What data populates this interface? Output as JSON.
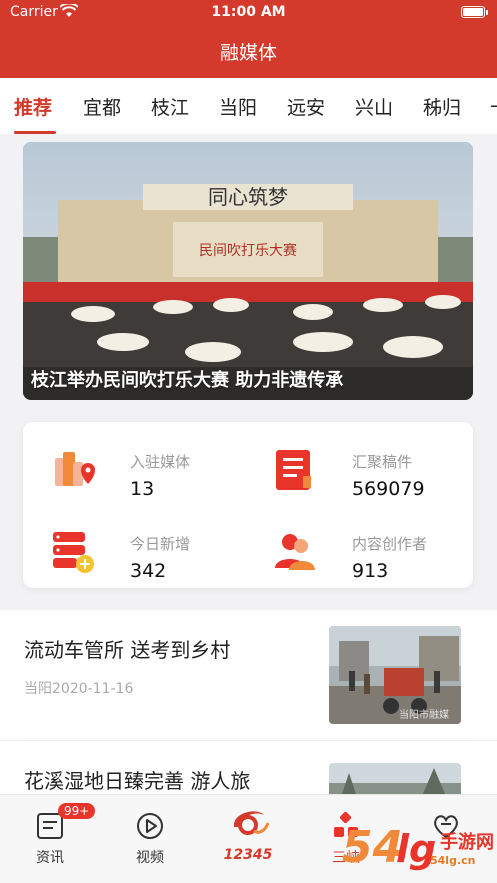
{
  "status_bar": {
    "carrier": "Carrier",
    "time": "11:00 AM"
  },
  "nav": {
    "title": "融媒体"
  },
  "channels": [
    "推荐",
    "宜都",
    "枝江",
    "当阳",
    "远安",
    "兴山",
    "秭归",
    "十"
  ],
  "active_channel": "推荐",
  "banner": {
    "caption": "枝江举办民间吹打乐大赛 助力非遗传承",
    "sign_text": "同心筑梦",
    "stage_text": "民间吹打乐大赛"
  },
  "stats": [
    {
      "label": "入驻媒体",
      "value": "13",
      "icon": "map-pin-building-icon"
    },
    {
      "label": "汇聚稿件",
      "value": "569079",
      "icon": "document-icon"
    },
    {
      "label": "今日新增",
      "value": "342",
      "icon": "server-add-icon"
    },
    {
      "label": "内容创作者",
      "value": "913",
      "icon": "users-icon"
    }
  ],
  "news": [
    {
      "headline": "流动车管所 送考到乡村",
      "meta": "当阳2020-11-16",
      "thumb_watermark": "当阳市融媒"
    },
    {
      "headline": "花溪湿地日臻完善 游人旅",
      "meta": ""
    }
  ],
  "tab_bar": {
    "items": [
      {
        "label": "资讯",
        "icon": "news-icon",
        "badge": "99+"
      },
      {
        "label": "视频",
        "icon": "play-icon"
      },
      {
        "label": "12345",
        "icon": "hotline-logo-icon"
      },
      {
        "label": "三峡",
        "icon": "grid-icon"
      },
      {
        "label": "",
        "icon": "heart-chat-icon"
      }
    ]
  },
  "watermark": {
    "text": "手游网",
    "domain": "54lg.cn"
  },
  "colors": {
    "brand_red": "#d43a2c",
    "accent_orange": "#f08a3a"
  }
}
